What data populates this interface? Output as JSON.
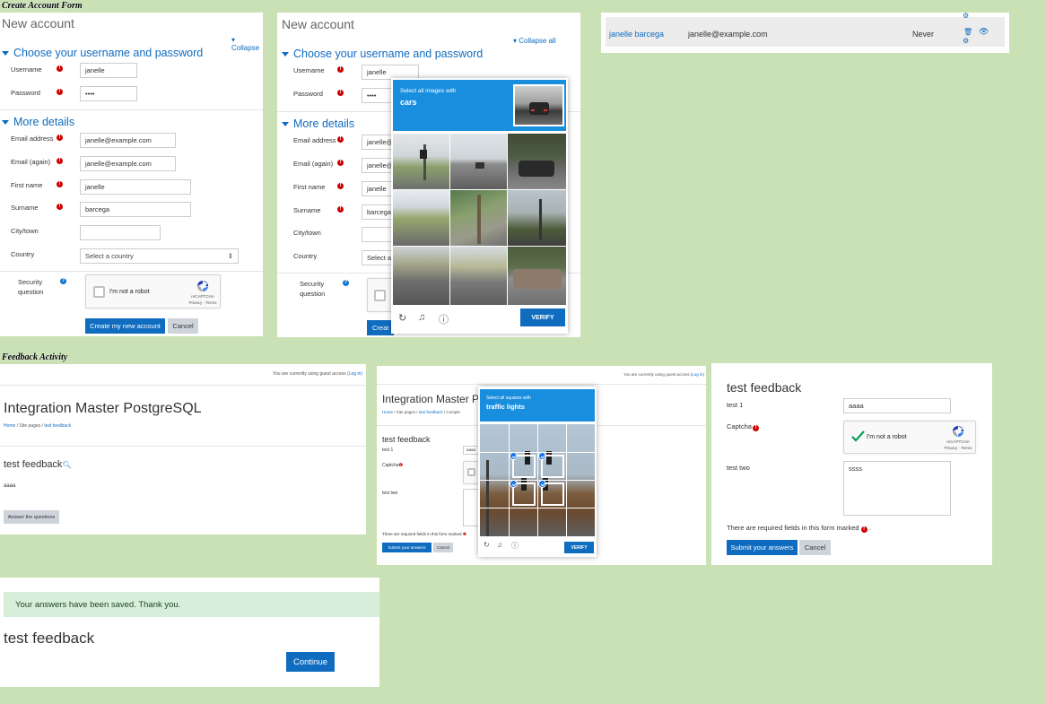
{
  "sections": {
    "create_account": "Create Account Form",
    "feedback": "Feedback Activity"
  },
  "account_form": {
    "title": "New account",
    "collapse_label": "Collapse",
    "collapse_all_label": "Collapse all",
    "section_username": "Choose your username and password",
    "section_details": "More details",
    "labels": {
      "username": "Username",
      "password": "Password",
      "email": "Email address",
      "email_again": "Email (again)",
      "first_name": "First name",
      "surname": "Surname",
      "city": "City/town",
      "country": "Country",
      "security": "Security question"
    },
    "values": {
      "username": "janelle",
      "password": "••••",
      "email": "janelle@example.com",
      "email_again": "janelle@example.com",
      "first_name": "janelle",
      "surname": "barcega",
      "city": "",
      "country": "Select a country",
      "email_trunc": "janelle@",
      "country_trunc": "Select a",
      "surname_trunc": "barcega"
    },
    "create_button": "Create my new account",
    "create_trunc": "Creat",
    "cancel_button": "Cancel"
  },
  "recaptcha": {
    "checkbox_label": "I'm not a robot",
    "brand": "reCAPTCHA",
    "terms": "Privacy - Terms"
  },
  "challenge_cars": {
    "instruction": "Select all images with",
    "target": "cars",
    "verify": "VERIFY"
  },
  "challenge_lights": {
    "instruction": "Select all squares with",
    "target": "traffic lights",
    "verify": "VERIFY"
  },
  "user_row": {
    "name": "janelle barcega",
    "email": "janelle@example.com",
    "last_access": "Never"
  },
  "feedback_page": {
    "guest_notice": "You are currently using guest access",
    "login_link": "(Log in)",
    "site_title": "Integration Master PostgreSQL",
    "site_title_trunc": "Integration Master P",
    "breadcrumb": [
      "Home",
      "Site pages",
      "test feedback"
    ],
    "breadcrumb_tail": "Comple",
    "activity_title": "test feedback",
    "answer_preview": "aaaa",
    "answer_button": "Answer the questions"
  },
  "feedback_form": {
    "title": "test feedback",
    "q1_label": "test 1",
    "q1_value": "aaaa",
    "captcha_label": "Captcha",
    "q2_label": "test two",
    "q2_value": "ssss",
    "required_note": "There are required fields in this form marked",
    "required_note_end": ".",
    "submit": "Submit your answers",
    "cancel": "Cancel"
  },
  "saved_page": {
    "message": "Your answers have been saved. Thank you.",
    "title": "test feedback",
    "continue": "Continue"
  },
  "colors": {
    "background": "#c9e1b5",
    "primary": "#0f6cbf",
    "required": "#cc0000",
    "recaptcha_blue": "#1a8ede",
    "success_bg": "#d7eedb"
  }
}
